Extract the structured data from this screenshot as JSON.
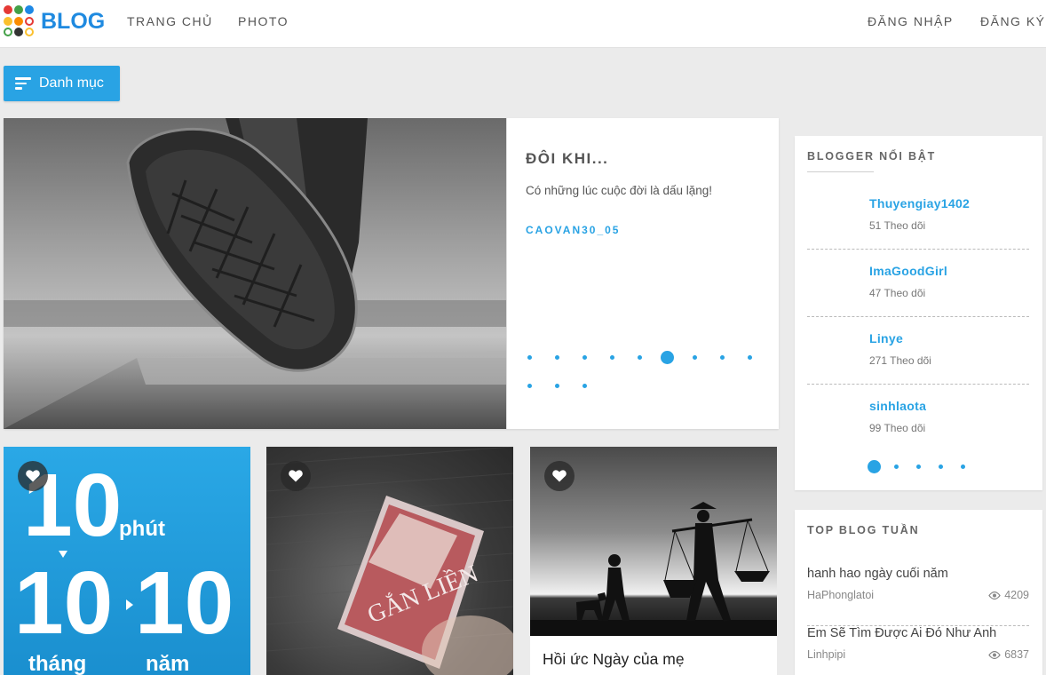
{
  "brand": {
    "logo_text": "BLOG"
  },
  "nav": {
    "home": "TRANG CHỦ",
    "photo": "PHOTO",
    "login": "ĐĂNG NHẬP",
    "register": "ĐĂNG KÝ"
  },
  "category_button": {
    "label": "Danh mục",
    "icon": "menu-lines-icon"
  },
  "featured": {
    "title": "ĐÔI KHI...",
    "description": "Có những lúc cuộc đời là dấu lặng!",
    "author": "CAOVAN30_05",
    "slide_count": 12,
    "active_slide": 6
  },
  "cards": [
    {
      "image_text": {
        "big_top": "10",
        "word_top": "phút",
        "big_left": "10",
        "big_right": "10",
        "word_left": "tháng",
        "word_right": "năm"
      },
      "caption": ""
    },
    {
      "image_text": {
        "book_title": "GẮN LIỀN"
      },
      "caption": ""
    },
    {
      "caption": "Hồi ức Ngày của mẹ"
    }
  ],
  "sidebar": {
    "bloggers": {
      "title": "BLOGGER NỔI BẬT",
      "items": [
        {
          "name": "Thuyengiay1402",
          "followers": "51 Theo dõi"
        },
        {
          "name": "ImaGoodGirl",
          "followers": "47 Theo dõi"
        },
        {
          "name": "Linye",
          "followers": "271 Theo dõi"
        },
        {
          "name": "sinhlaota",
          "followers": "99 Theo dõi"
        }
      ],
      "page_count": 5,
      "active_page": 1
    },
    "top_blogs": {
      "title": "TOP BLOG TUẦN",
      "items": [
        {
          "title": "hanh hao ngày cuối năm",
          "author": "HaPhonglatoi",
          "views": "4209"
        },
        {
          "title": "Em Sẽ Tìm Được Ai Đó Như Anh",
          "author": "Linhpipi",
          "views": "6837"
        }
      ]
    }
  },
  "colors": {
    "accent": "#29a3e4",
    "background": "#ebebeb"
  }
}
